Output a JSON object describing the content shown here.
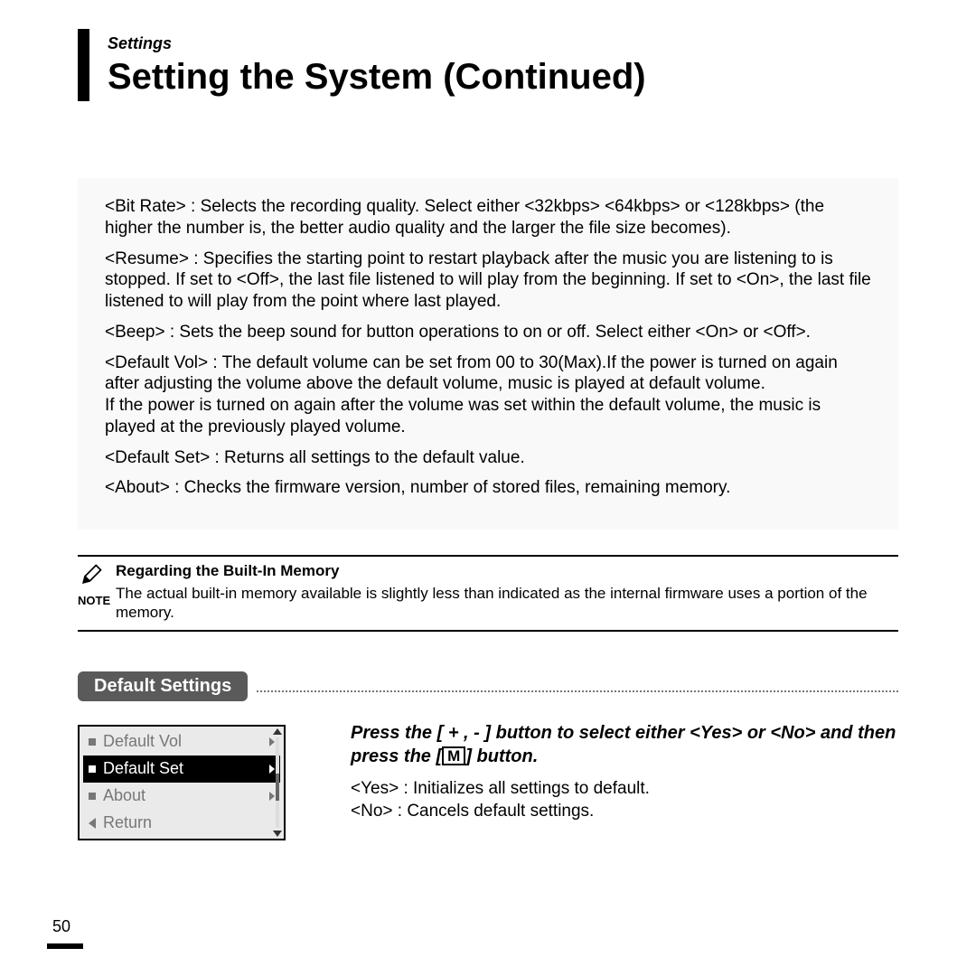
{
  "breadcrumb": "Settings",
  "title_main": "Setting the System ",
  "title_cont": "(Continued)",
  "box": {
    "p1": "<Bit Rate> : Selects the recording quality. Select either <32kbps> <64kbps> or <128kbps> (the higher the number is, the better audio quality and the larger the file size becomes).",
    "p2": "<Resume> : Specifies the starting point to restart playback after the music you are listening to is stopped. If set to <Off>, the last file listened to will play from the beginning. If set to <On>, the last file listened to will play from the point where last played.",
    "p3": "<Beep> : Sets the beep sound for button operations to on or off. Select either <On> or <Off>.",
    "p4": "<Default Vol> : The default volume can be set from 00 to 30(Max).If the power is turned on again after adjusting the volume above the default volume, music is played at default volume.\nIf the power is turned on again after the volume was set within the default volume, the music is played at the previously played volume.",
    "p5": "<Default Set> : Returns all settings to the default value.",
    "p6": "<About> : Checks the firmware version, number of stored files, remaining memory."
  },
  "note": {
    "label": "NOTE",
    "title": "Regarding the Built-In Memory",
    "text": "The actual built-in memory available is slightly less than indicated as the internal firmware uses a portion of the memory."
  },
  "section_title": "Default Settings",
  "screen": {
    "items": [
      {
        "label": "Default Vol",
        "type": "sq",
        "chev": true,
        "sel": false
      },
      {
        "label": "Default Set",
        "type": "sq",
        "chev": true,
        "sel": true
      },
      {
        "label": "About",
        "type": "sq",
        "chev": true,
        "sel": false
      },
      {
        "label": "Return",
        "type": "tri",
        "chev": false,
        "sel": false
      }
    ]
  },
  "instr": {
    "line1a": "Press the [ + , - ] button to select either <Yes> or <No> and then press the [",
    "line1b": "M",
    "line1c": "] button.",
    "yes": "<Yes> :  Initializes all settings to default.",
    "no": "<No> : Cancels default settings."
  },
  "page_number": "50"
}
